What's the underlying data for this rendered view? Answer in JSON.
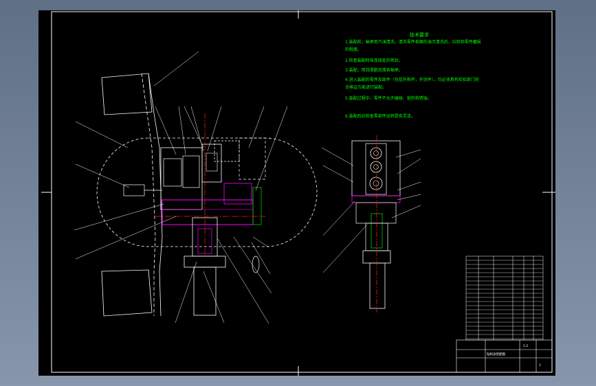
{
  "drawing": {
    "notes_title": "技术要求",
    "notes": [
      "1.装配前，轴承用汽油清洗，清洗零件表面的油污清洗后，应检验零件磨损",
      "的程度。",
      "2.检查装配时各连接处的密封。",
      "3.装配，用润滑脂润滑各轴承。",
      "4.进入装配的零件及部件（包括外购件，外协件），均必须具有检验部门的",
      "合格证方能进行装配。",
      "5.装配过程中，零件不允许磕碰、划伤和锈蚀。",
      "6.装配后应检查零部件运转是否灵活。"
    ],
    "title_block": {
      "drawing_name": "钻机总装配图",
      "scale": "1:2",
      "sheet_no": "1"
    },
    "colors": {
      "sheet": "#000000",
      "lines": "#ffffff",
      "notes": "#00ff00",
      "center": "#ff2020",
      "accent_magenta": "#ff00ff",
      "accent_green": "#00cc00"
    }
  }
}
